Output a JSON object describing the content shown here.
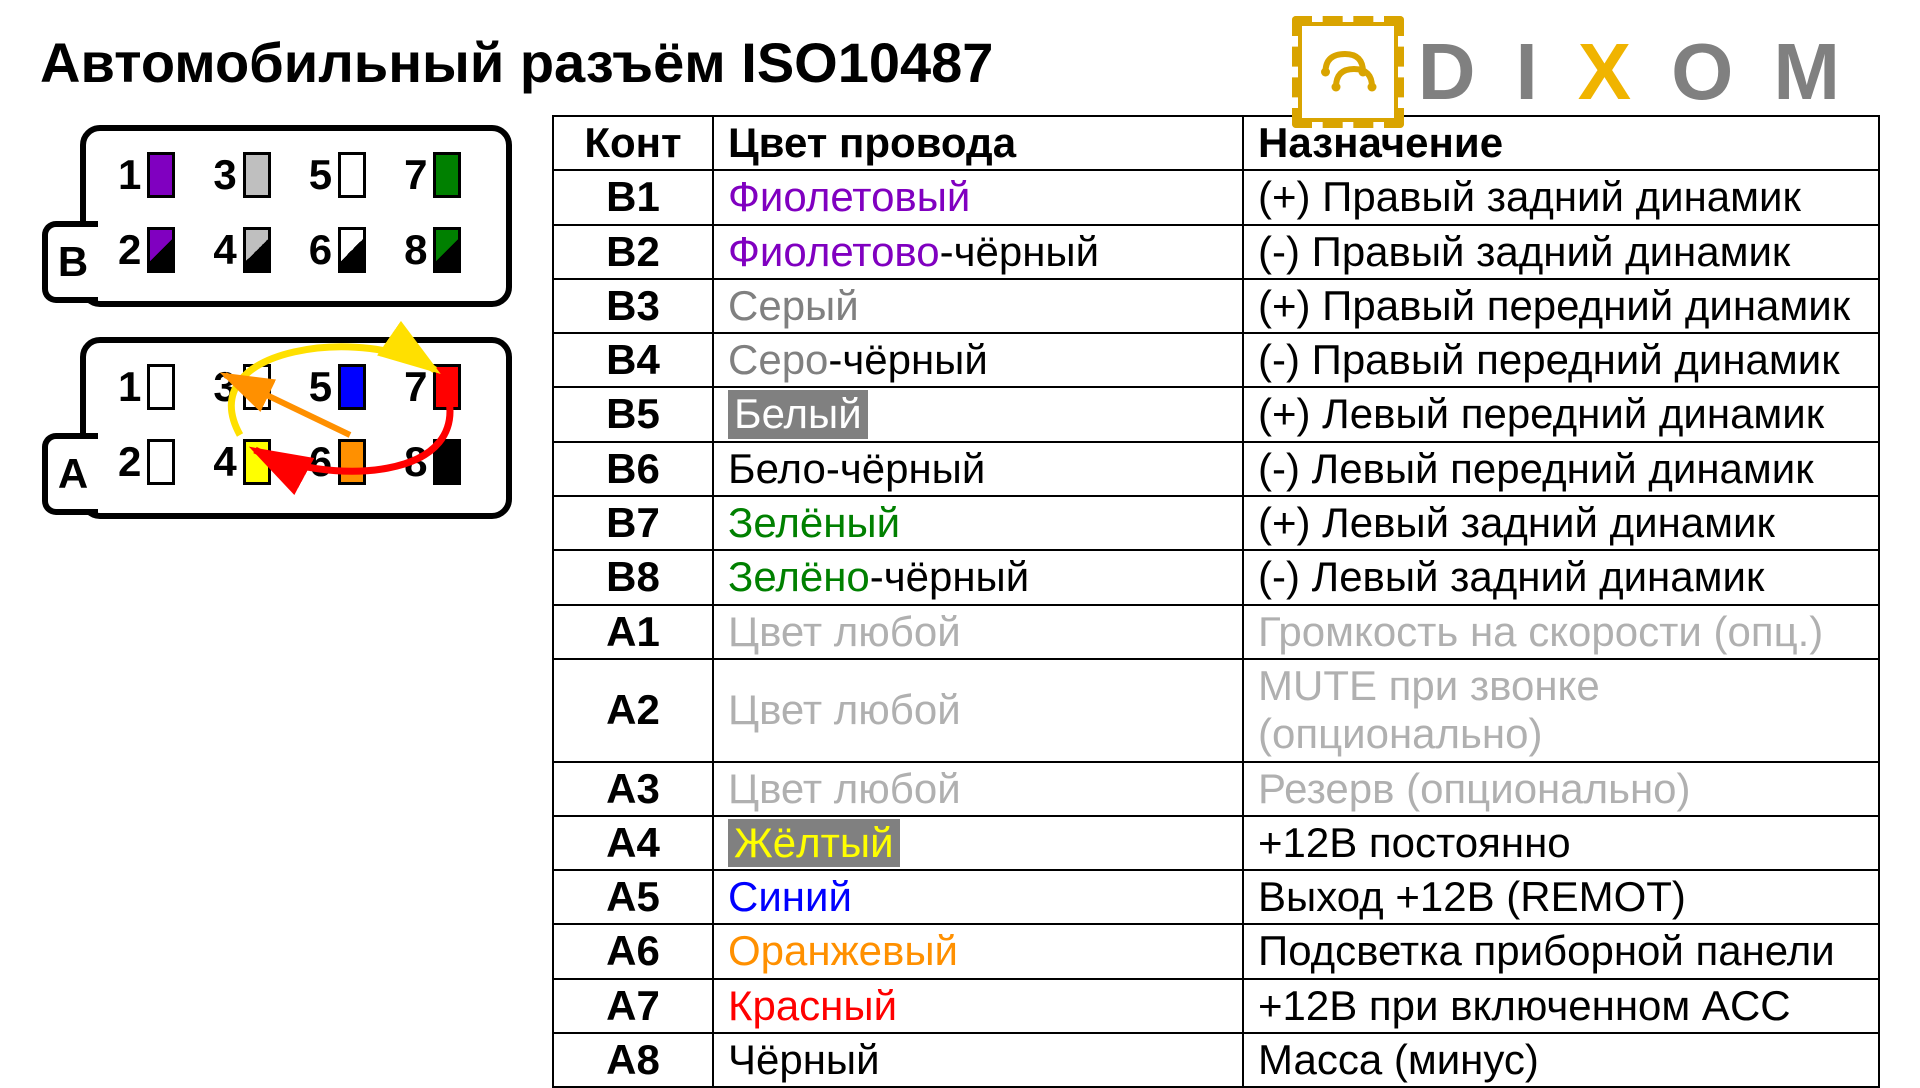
{
  "title": "Автомобильный разъём ISO10487",
  "logo": {
    "letters": [
      "D",
      "I",
      "X",
      "O",
      "M"
    ]
  },
  "connector": {
    "blocks": [
      {
        "label": "B",
        "row1": [
          {
            "n": "1",
            "fill": "#8000c0"
          },
          {
            "n": "3",
            "fill": "#bfbfbf"
          },
          {
            "n": "5",
            "fill": "#ffffff"
          },
          {
            "n": "7",
            "fill": "#008000"
          }
        ],
        "row2": [
          {
            "n": "2",
            "fill": "#8000c0",
            "diag": "#000"
          },
          {
            "n": "4",
            "fill": "#bfbfbf",
            "diag": "#000"
          },
          {
            "n": "6",
            "fill": "#ffffff",
            "diag": "#000"
          },
          {
            "n": "8",
            "fill": "#008000",
            "diag": "#000"
          }
        ]
      },
      {
        "label": "A",
        "row1": [
          {
            "n": "1",
            "fill": "#ffffff"
          },
          {
            "n": "3",
            "fill": "#ffffff"
          },
          {
            "n": "5",
            "fill": "#0000ff"
          },
          {
            "n": "7",
            "fill": "#ff0000"
          }
        ],
        "row2": [
          {
            "n": "2",
            "fill": "#ffffff"
          },
          {
            "n": "4",
            "fill": "#ffff00"
          },
          {
            "n": "6",
            "fill": "#ff9000"
          },
          {
            "n": "8",
            "fill": "#000000"
          }
        ]
      }
    ]
  },
  "table": {
    "headers": {
      "pin": "Конт",
      "color": "Цвет провода",
      "fn": "Назначение"
    },
    "rows": [
      {
        "pin": "B1",
        "color": [
          {
            "t": "Фиолетовый",
            "c": "#8000c0"
          }
        ],
        "fn": "(+) Правый задний динамик"
      },
      {
        "pin": "B2",
        "color": [
          {
            "t": "Фиолетово",
            "c": "#8000c0"
          },
          {
            "t": "-чёрный",
            "c": "#000"
          }
        ],
        "fn": "(-)  Правый задний динамик"
      },
      {
        "pin": "B3",
        "color": [
          {
            "t": "Серый",
            "c": "#808080"
          }
        ],
        "fn": "(+) Правый передний динамик"
      },
      {
        "pin": "B4",
        "color": [
          {
            "t": "Серо",
            "c": "#808080"
          },
          {
            "t": "-чёрный",
            "c": "#000"
          }
        ],
        "fn": "(-)  Правый передний динамик"
      },
      {
        "pin": "B5",
        "color": [
          {
            "t": "Белый",
            "c": "#fff",
            "bg": "#808080"
          }
        ],
        "fn": "(+) Левый передний динамик"
      },
      {
        "pin": "B6",
        "color": [
          {
            "t": "Бело-чёрный",
            "c": "#000"
          }
        ],
        "fn": "(-)  Левый передний динамик"
      },
      {
        "pin": "B7",
        "color": [
          {
            "t": "Зелёный",
            "c": "#008000"
          }
        ],
        "fn": "(+) Левый задний динамик"
      },
      {
        "pin": "B8",
        "color": [
          {
            "t": "Зелёно",
            "c": "#008000"
          },
          {
            "t": "-чёрный",
            "c": "#000"
          }
        ],
        "fn": "(-)  Левый задний динамик"
      },
      {
        "pin": "A1",
        "color": [
          {
            "t": "Цвет любой",
            "c": "#b0b0b0"
          }
        ],
        "fn": "Громкость на скорости (опц.)",
        "fnc": "#b0b0b0"
      },
      {
        "pin": "A2",
        "color": [
          {
            "t": "Цвет любой",
            "c": "#b0b0b0"
          }
        ],
        "fn": "MUTE при звонке (опционально)",
        "fnc": "#b0b0b0"
      },
      {
        "pin": "A3",
        "color": [
          {
            "t": "Цвет любой",
            "c": "#b0b0b0"
          }
        ],
        "fn": "Резерв (опционально)",
        "fnc": "#b0b0b0"
      },
      {
        "pin": "A4",
        "color": [
          {
            "t": "Жёлтый",
            "c": "#ffff00",
            "bg": "#808080"
          }
        ],
        "fn": "+12В постоянно"
      },
      {
        "pin": "A5",
        "color": [
          {
            "t": "Синий",
            "c": "#0000ff"
          }
        ],
        "fn": "Выход +12В (REMOT)"
      },
      {
        "pin": "A6",
        "color": [
          {
            "t": "Оранжевый",
            "c": "#ff9000"
          }
        ],
        "fn": "Подсветка приборной панели"
      },
      {
        "pin": "A7",
        "color": [
          {
            "t": "Красный",
            "c": "#ff0000"
          }
        ],
        "fn": "+12В при включенном ACC"
      },
      {
        "pin": "A8",
        "color": [
          {
            "t": "Чёрный",
            "c": "#000"
          }
        ],
        "fn": "Масса (минус)"
      }
    ]
  }
}
